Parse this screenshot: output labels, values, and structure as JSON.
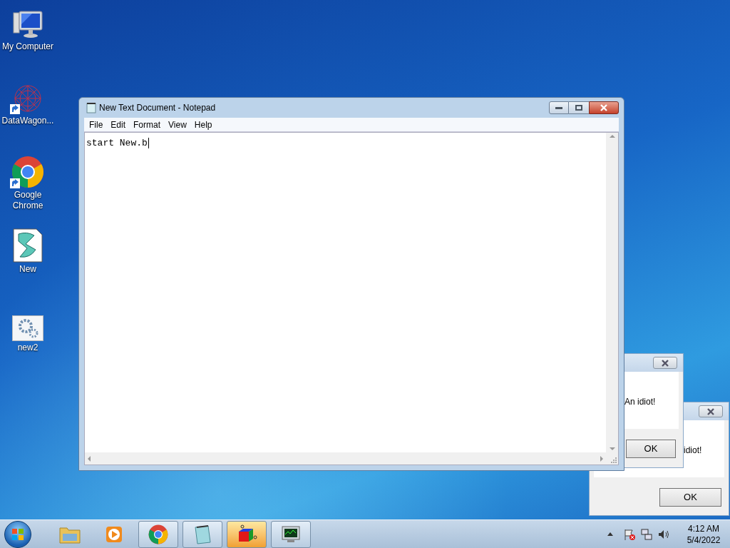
{
  "desktop_icons": [
    {
      "kind": "computer",
      "label": "My Computer",
      "shortcut": false
    },
    {
      "kind": "network",
      "label": "DataWagon...",
      "shortcut": true
    },
    {
      "kind": "chrome",
      "label": "Google Chrome",
      "shortcut": true
    },
    {
      "kind": "script",
      "label": "New",
      "shortcut": false
    },
    {
      "kind": "gears",
      "label": "new2",
      "shortcut": false
    }
  ],
  "notepad": {
    "title": "New Text Document - Notepad",
    "menu": [
      "File",
      "Edit",
      "Format",
      "View",
      "Help"
    ],
    "text": "start New.b"
  },
  "dialogs": [
    {
      "message": "idiot!",
      "button": "OK"
    },
    {
      "message": "An idiot!",
      "button": "OK"
    }
  ],
  "taskbar": {
    "items": [
      {
        "kind": "explorer",
        "running": false,
        "selected": false
      },
      {
        "kind": "media",
        "running": false,
        "selected": false
      },
      {
        "kind": "chrome",
        "running": true,
        "selected": false
      },
      {
        "kind": "notepad",
        "running": true,
        "selected": false
      },
      {
        "kind": "cube",
        "running": true,
        "selected": true
      },
      {
        "kind": "monitor",
        "running": true,
        "selected": false
      }
    ],
    "time": "4:12 AM",
    "date": "5/4/2022"
  }
}
